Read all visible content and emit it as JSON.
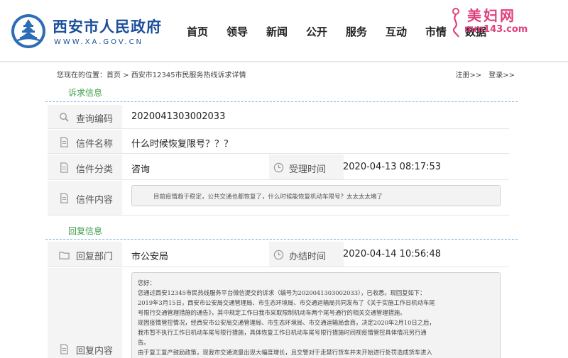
{
  "header": {
    "site_title": "西安市人民政府",
    "site_url": "WWW.XA.GOV.CN",
    "nav": [
      "首页",
      "领导",
      "新闻",
      "公开",
      "服务",
      "互动",
      "市情",
      "数据"
    ]
  },
  "watermark": {
    "title": "美妇网",
    "url": "mm143.com"
  },
  "breadcrumb": {
    "prefix": "您现在的位置：",
    "home": "首页",
    "separator": " > ",
    "current": "西安市12345市民服务热线诉求详情",
    "register": "注册>>",
    "login": "登录>>"
  },
  "appeal": {
    "section_title": "诉求信息",
    "query_code_label": "查询编码",
    "query_code": "2020041303002033",
    "letter_name_label": "信件名称",
    "letter_name": "什么时候恢复限号？？？",
    "letter_type_label": "信件分类",
    "letter_type": "咨询",
    "accept_time_label": "受理时间",
    "accept_time": "2020-04-13 08:17:53",
    "letter_content_label": "信件内容",
    "letter_content": "目前疫情趋于稳定，公共交通也都恢复了，什么时候能恢复机动车限号？太太太太堵了"
  },
  "reply": {
    "section_title": "回复信息",
    "dept_label": "回复部门",
    "dept": "市公安局",
    "done_time_label": "办结时间",
    "done_time": "2020-04-14 10:56:48",
    "content_label": "回复内容",
    "lines": [
      "您好：",
      "您通过西安12345市民热线服务平台微信提交的诉求（编号为2020041303002033），已收悉。现回复如下：",
      "2019年3月15日，西安市公安局交通管理局、市生态环境局、市交通运输局共同发布了《关于实施工作日机动车尾",
      "号限行交通管理措施的通告》，其中规定工作日我市采取限制机动车两个尾号通行的相关交通管理措施。",
      "现因疫情管控情况，经西安市公安局交通管理局、市生态环境局、市交通运输局会商，决定2020年2月10日之后，",
      "我市暂不执行工作日机动车尾号限行措施，具体恢复工作日机动车尾号限行措施时间视疫情管控具体情况另行通",
      "告。",
      "由于复工复产鼓励政策，现我市交通流量出现大幅度增长，且交警对于走禁行货车并未开始进行处罚造成货车进入"
    ]
  },
  "colors": {
    "brand_blue": "#1b4e9b",
    "section_green": "#3a9b47",
    "watermark_pink": "#e0407e"
  }
}
